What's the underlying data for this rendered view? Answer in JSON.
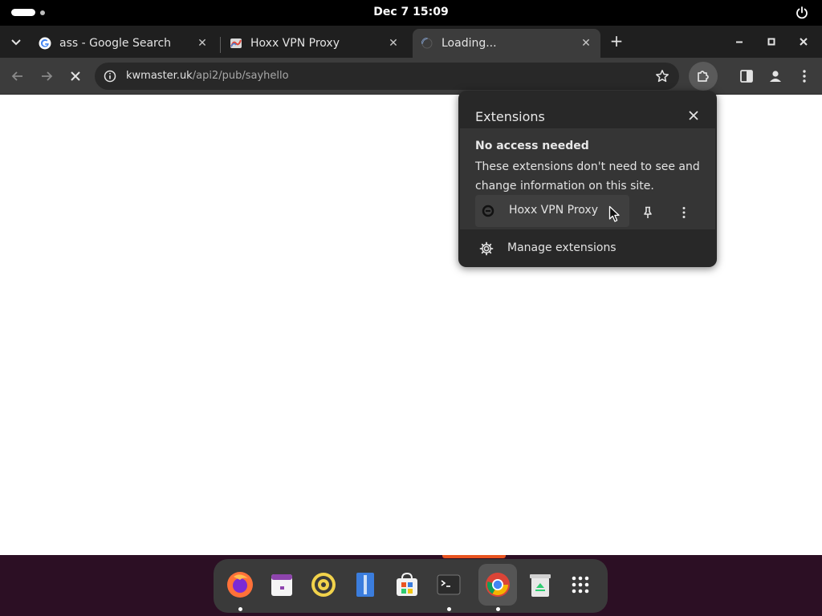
{
  "topbar": {
    "clock": "Dec 7  15:09"
  },
  "tabs": [
    {
      "title": "ass - Google Search",
      "favicon": "google-icon"
    },
    {
      "title": "Hoxx VPN Proxy",
      "favicon": "hoxx-icon"
    },
    {
      "title": "Loading...",
      "favicon": "loading-spinner-icon"
    }
  ],
  "omnibox": {
    "host": "kwmaster.uk",
    "path": "/api2/pub/sayhello"
  },
  "extensions_popup": {
    "title": "Extensions",
    "section_heading": "No access needed",
    "section_description": "These extensions don't need to see and change information on this site.",
    "item_name": "Hoxx VPN Proxy",
    "manage_label": "Manage extensions"
  },
  "dock": {
    "apps": [
      "firefox-icon",
      "calendar-icon",
      "rhythmbox-icon",
      "text-editor-icon",
      "software-center-icon",
      "terminal-icon",
      "chrome-icon",
      "trash-icon",
      "app-grid-icon"
    ]
  },
  "colors": {
    "chrome_dark": "#3c3c3c",
    "tabstrip": "#1f1f1f",
    "popup": "#282828",
    "dock_accent": "#e95420"
  }
}
